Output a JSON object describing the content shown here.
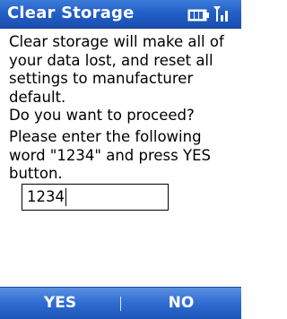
{
  "title_bar": {
    "title": "Clear Storage",
    "icons": [
      "battery-icon",
      "signal-icon"
    ]
  },
  "message": {
    "warning": "Clear storage will make all of\nyour data lost, and reset all\nsettings to manufacturer\ndefault.\nDo you want to proceed?",
    "instruction": "Please enter the following\nword \"1234\" and press YES\nbutton."
  },
  "code_input": {
    "value": "1234"
  },
  "softkeys": {
    "left": "YES",
    "right": "NO"
  },
  "colors": {
    "title_bar": "#2360c7",
    "softkey_bar": "#2f6cd1",
    "text": "#000000",
    "background": "#ffffff"
  }
}
